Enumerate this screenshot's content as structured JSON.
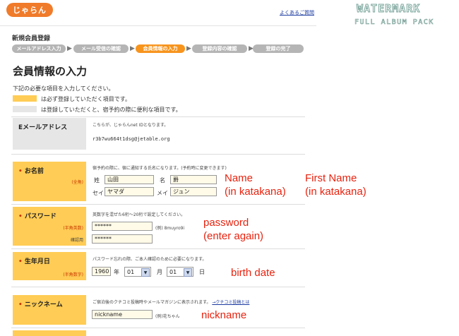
{
  "header": {
    "logo": "じゃらん",
    "help_link": "よくあるご質問",
    "watermark_line1": "WATERMARK",
    "watermark_line2": "FULL ALBUM PACK"
  },
  "steps": {
    "title": "新規会員登録",
    "items": [
      {
        "label": "メールアドレス入力",
        "active": false
      },
      {
        "label": "メール受信の確認",
        "active": false
      },
      {
        "label": "会員情報の入力",
        "active": true
      },
      {
        "label": "登録内容の確認",
        "active": false
      },
      {
        "label": "登録の完了",
        "active": false
      }
    ]
  },
  "page": {
    "title": "会員情報の入力",
    "intro": "下記の必要な項目を入力してください。",
    "legend_required": "は必ず登録していただく項目です。",
    "legend_optional": "は登録していただくと、宿予約の際に便利な項目です。"
  },
  "email_row": {
    "label": "Eメールアドレス",
    "note": "こちらが、じゃらんnet IDとなります。",
    "value": "r3b7wu664t1dsg@jetable.org"
  },
  "name_row": {
    "label": "お名前",
    "sub": "(全角)",
    "note": "宿予約の際に、宿に通知する氏名になります。(予約時に変更できます)",
    "last_label": "姓",
    "last_value": "山田",
    "first_label": "名",
    "first_value": "爵",
    "last_kana_label": "セイ",
    "last_kana_value": "ヤマダ",
    "first_kana_label": "メイ",
    "first_kana_value": "ジュン",
    "annotation_name": [
      "Name",
      "(in katakana)"
    ],
    "annotation_first": [
      "First Name",
      "(in katakana)"
    ]
  },
  "password_row": {
    "label": "パスワード",
    "sub": "(半角英数)",
    "note": "英数字を混ぜた6桁〜20桁で設定してください。",
    "value": "******",
    "example": "(例) 8muyro9i",
    "confirm_label": "確認用",
    "confirm_value": "******",
    "annotation": [
      "password",
      "(enter again)"
    ]
  },
  "birth_row": {
    "label": "生年月日",
    "sub": "(半角数字)",
    "note": "パスワード忘れの際、ご本人確認のために必要になります。",
    "year": "1960",
    "year_unit": "年",
    "month": "01",
    "month_unit": "月",
    "day": "01",
    "day_unit": "日",
    "annotation": "birth date"
  },
  "nickname_row": {
    "label": "ニックネーム",
    "note": "ご宿泊後のクチコミ投稿時やメールマガジンに表示されます。",
    "note_link": "→クチコミ投稿とは",
    "value": "nickname",
    "example": "(例)花ちゃん",
    "annotation": "nickname"
  },
  "colors": {
    "required": "#ffcc55",
    "optional": "#e6e6e6",
    "active_step": "#f7941d",
    "annotation": "#e8230f"
  }
}
